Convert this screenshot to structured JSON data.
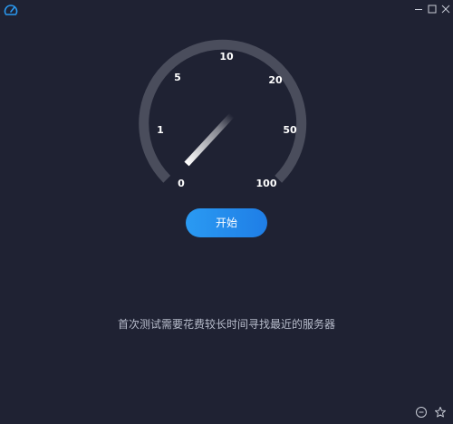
{
  "window": {
    "icons": {
      "app": "speedometer-icon",
      "minimize": "minimize-icon",
      "maximize": "maximize-icon",
      "close": "close-icon"
    }
  },
  "gauge": {
    "scale_labels": [
      "0",
      "1",
      "5",
      "10",
      "20",
      "50",
      "100"
    ],
    "needle_value": "0"
  },
  "actions": {
    "start_label": "开始"
  },
  "status": {
    "message": "首次测试需要花费较长时间寻找最近的服务器"
  },
  "footer": {
    "icons": {
      "settings": "circle-minus-icon",
      "favorite": "star-icon"
    }
  },
  "colors": {
    "background": "#1f2233",
    "accent": "#2a9af2",
    "gauge_track": "#4a4d5c",
    "text_muted": "#b7bccb"
  }
}
